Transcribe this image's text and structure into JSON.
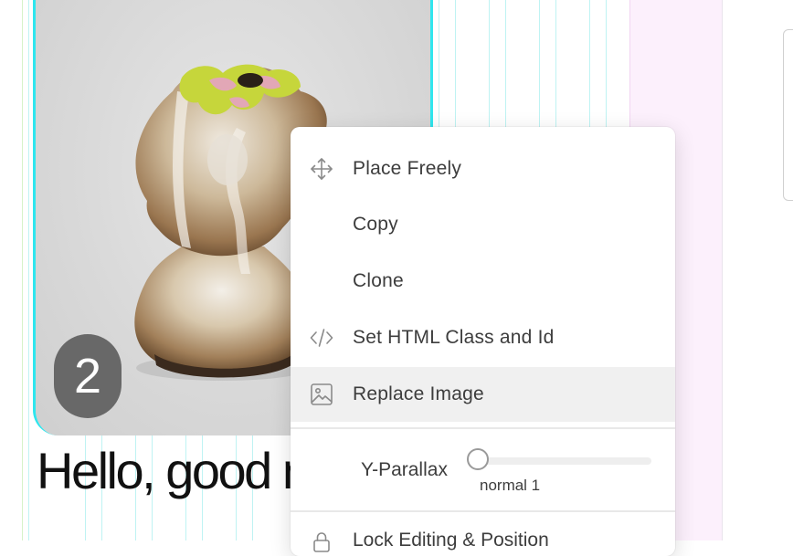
{
  "canvas": {
    "slide_number": "2",
    "heading": "Hello, good morning!",
    "image_alt": "ceramic sculpture with green and pink glaze"
  },
  "context_menu": {
    "items": [
      {
        "label": "Place Freely",
        "icon": "move-arrows-icon"
      },
      {
        "label": "Copy",
        "icon": ""
      },
      {
        "label": "Clone",
        "icon": ""
      },
      {
        "label": "Set HTML Class and Id",
        "icon": "code-icon"
      },
      {
        "label": "Replace Image",
        "icon": "image-icon",
        "active": true
      }
    ],
    "parallax": {
      "label": "Y-Parallax",
      "value_label": "normal 1",
      "value": 0
    },
    "partial_item": {
      "label": "Lock Editing & Position",
      "icon": "lock-icon"
    }
  },
  "colors": {
    "selection_outline": "#2ee6ee",
    "grid_guide": "#bff3f3",
    "pink_column": "#fcf0fc",
    "badge": "#686868",
    "menu_active": "#f0f0f0",
    "text": "#3d3d3d"
  }
}
